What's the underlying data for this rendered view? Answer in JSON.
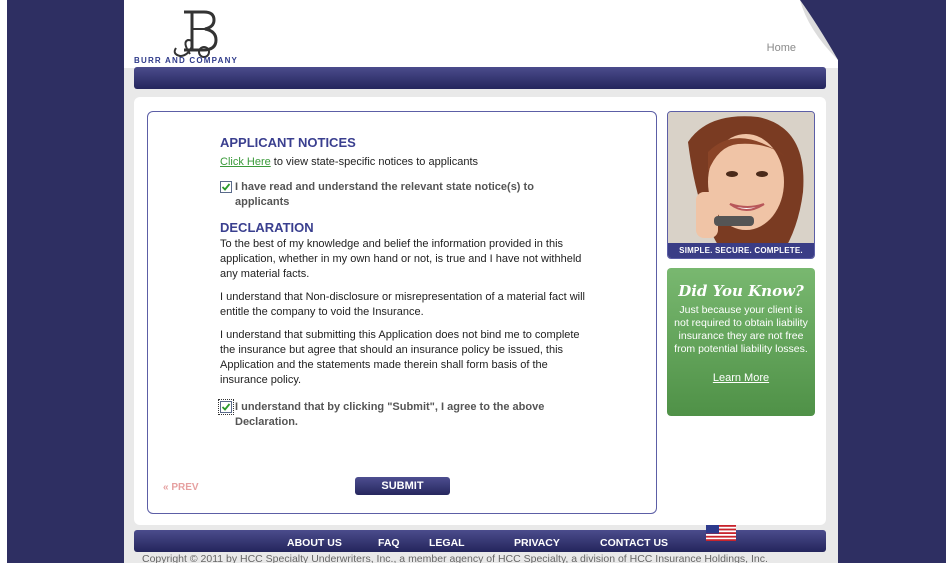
{
  "header": {
    "company_name": "BURR AND COMPANY",
    "home_link": "Home"
  },
  "applicant_notices": {
    "title": "APPLICANT NOTICES",
    "click_here": "Click Here",
    "click_here_suffix": " to view state-specific notices to applicants",
    "checkbox_label": "I have read and understand the relevant state notice(s) to applicants",
    "checked": true
  },
  "declaration": {
    "title": "DECLARATION",
    "paragraphs": [
      "To the best of my knowledge and belief the information provided in this application, whether in my own hand or not, is true and I have not withheld any material facts.",
      "I understand that Non-disclosure or misrepresentation of a material fact will entitle the company to void the Insurance.",
      "I understand that submitting this Application does not bind me to complete the insurance but agree that should an insurance policy be issued, this Application and the statements made therein shall form basis of the insurance policy."
    ],
    "checkbox_label": "I understand that by clicking \"Submit\", I agree to the above Declaration.",
    "checked": true
  },
  "actions": {
    "prev_label": "« PREV",
    "submit_label": "SUBMIT"
  },
  "sidebar": {
    "photo_caption": "SIMPLE. SECURE. COMPLETE.",
    "did_you_know_title": "Did You Know?",
    "did_you_know_text": "Just because your client is not required to obtain liability insurance they are not free from potential liability losses.",
    "learn_more": "Learn More"
  },
  "footer": {
    "links": [
      "ABOUT US",
      "FAQ",
      "LEGAL",
      "PRIVACY",
      "CONTACT US"
    ],
    "copyright": "Copyright © 2011 by HCC Specialty Underwriters, Inc., a member agency of HCC Specialty, a division of HCC Insurance Holdings, Inc."
  },
  "colors": {
    "background": "#2e2f62",
    "accent": "#3a3f8f",
    "green": "#5fa356"
  }
}
